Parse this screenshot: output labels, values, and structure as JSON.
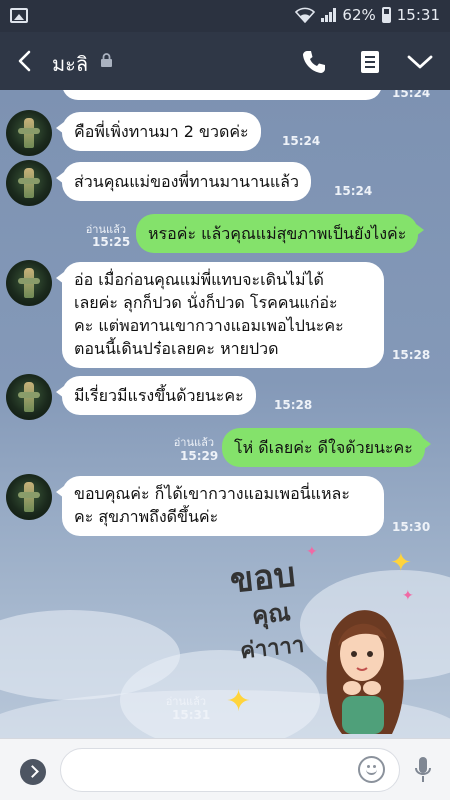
{
  "status": {
    "battery": "62%",
    "time": "15:31"
  },
  "header": {
    "title": "มะลิ"
  },
  "messages": {
    "top_time": "15:24",
    "m1": {
      "text": "คือพี่เพิ่งทานมา 2 ขวดค่ะ",
      "time": "15:24"
    },
    "m2": {
      "text": "ส่วนคุณแม่ของพี่ทานมานานแล้ว",
      "time": "15:24"
    },
    "m3": {
      "read": "อ่านแล้ว",
      "time": "15:25",
      "text": "หรอค่ะ แล้วคุณแม่สุขภาพเป็นยังไงค่ะ"
    },
    "m4": {
      "lines": [
        "อ่อ เมื่อก่อนคุณแม่พี่แทบจะเดินไม่ได้",
        "เลยค่ะ ลุกก็ปวด นั่งก็ปวด โรคคนแก่อ่ะ",
        "คะ แต่พอทานเขากวางแอมเพอไปนะคะ",
        "ตอนนี้เดินปร๋อเลยคะ หายปวด"
      ],
      "time": "15:28"
    },
    "m5": {
      "text": "มีเรี่ยวมีแรงขึ้นด้วยนะคะ",
      "time": "15:28"
    },
    "m6": {
      "read": "อ่านแล้ว",
      "time": "15:29",
      "text": "โห่ ดีเลยค่ะ ดีใจด้วยนะคะ"
    },
    "m7": {
      "lines": [
        "ขอบคุณค่ะ ก็ได้เขากวางแอมเพอนี่แหละ",
        "คะ สุขภาพถึงดีขึ้นค่ะ"
      ],
      "time": "15:30"
    },
    "m8": {
      "read": "อ่านแล้ว",
      "time": "15:31"
    }
  },
  "sticker": {
    "line1": "ขอบ",
    "line2": "คุณ",
    "line3": "ค่าาาา"
  },
  "input": {
    "placeholder": ""
  },
  "colors": {
    "header": "#2f3746",
    "my_bubble": "#84e26b",
    "other_bubble": "#ffffff"
  },
  "icons": [
    "back-icon",
    "lock-icon",
    "phone-icon",
    "notes-icon",
    "chevron-down-icon",
    "expand-icon",
    "emoji-icon",
    "mic-icon"
  ]
}
